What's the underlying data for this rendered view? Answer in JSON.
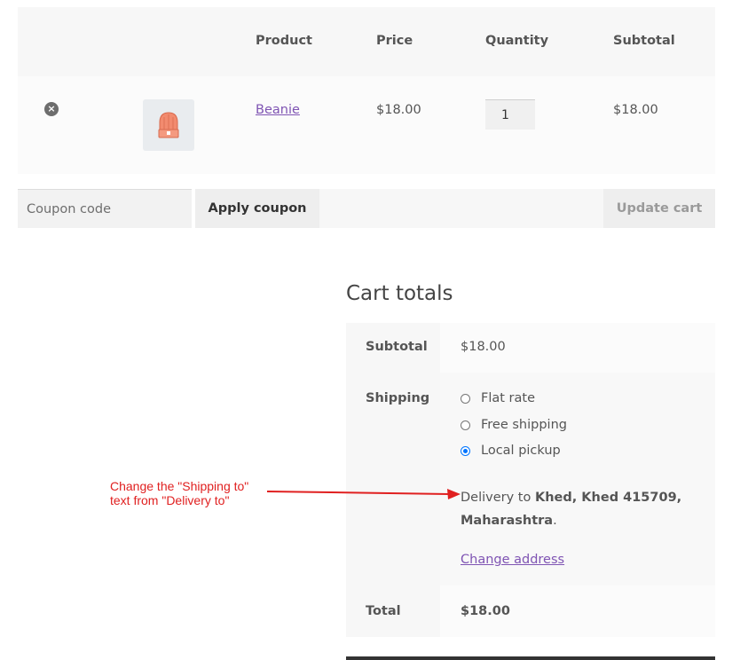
{
  "cart_table": {
    "headers": {
      "product": "Product",
      "price": "Price",
      "quantity": "Quantity",
      "subtotal": "Subtotal"
    },
    "items": [
      {
        "name": "Beanie",
        "price": "$18.00",
        "quantity": "1",
        "subtotal": "$18.00",
        "remove_icon": "×"
      }
    ]
  },
  "coupon": {
    "placeholder": "Coupon code",
    "apply_label": "Apply coupon"
  },
  "update_cart_label": "Update cart",
  "cart_totals": {
    "title": "Cart totals",
    "subtotal_label": "Subtotal",
    "subtotal_value": "$18.00",
    "shipping_label": "Shipping",
    "shipping_options": [
      {
        "label": "Flat rate",
        "checked": false
      },
      {
        "label": "Free shipping",
        "checked": false
      },
      {
        "label": "Local pickup",
        "checked": true
      }
    ],
    "delivery_prefix": "Delivery to ",
    "delivery_address": "Khed, Khed 415709, Maharashtra",
    "delivery_suffix": ".",
    "change_address_label": "Change address",
    "total_label": "Total",
    "total_value": "$18.00"
  },
  "annotation": {
    "line1": "Change the \"Shipping to\"",
    "line2": "text from \"Delivery to\"",
    "color": "#e02020"
  },
  "colors": {
    "link": "#7f54b3",
    "radio_accent": "#0075ff"
  }
}
